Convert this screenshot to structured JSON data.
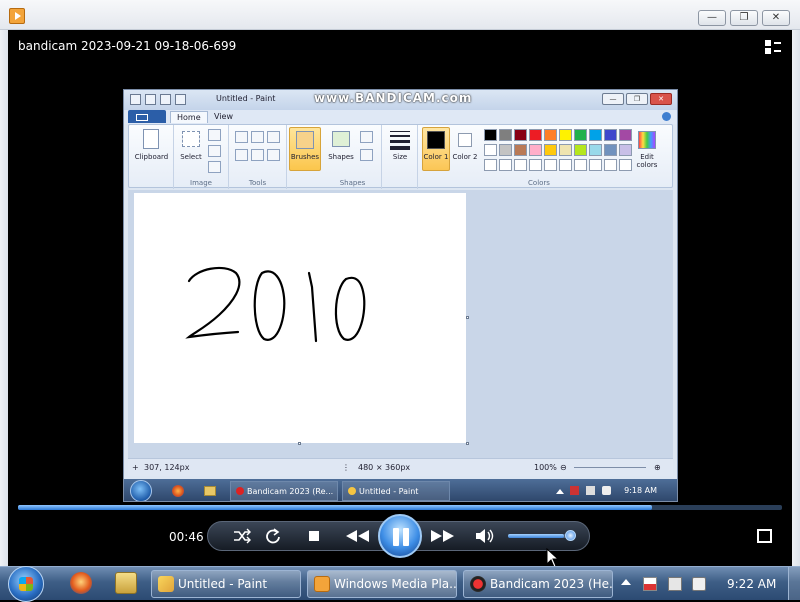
{
  "window": {
    "minimize": "—",
    "maximize": "❐",
    "close": "✕"
  },
  "player": {
    "video_title": "bandicam 2023-09-21 09-18-06-699",
    "elapsed": "00:46",
    "progress": 0.83,
    "volume": 0.9
  },
  "recording": {
    "paint": {
      "title": "Untitled - Paint",
      "watermark": "www.BANDICAM.com",
      "tabs": [
        "Home",
        "View"
      ],
      "groups": {
        "clipboard": "Clipboard",
        "image": "Image",
        "select": "Select",
        "tools": "Tools",
        "brushes": "Brushes",
        "shapes_btn": "Shapes",
        "shapes": "Shapes",
        "size": "Size",
        "color1": "Color 1",
        "color2": "Color 2",
        "edit_colors": "Edit colors",
        "colors": "Colors"
      },
      "palette_row1": [
        "#000000",
        "#7f7f7f",
        "#880015",
        "#ed1c24",
        "#ff7f27",
        "#fff200",
        "#22b14c",
        "#00a2e8",
        "#3f48cc",
        "#a349a4"
      ],
      "palette_row2": [
        "#ffffff",
        "#c3c3c3",
        "#b97a57",
        "#ffaec9",
        "#ffc90e",
        "#efe4b0",
        "#b5e61d",
        "#99d9ea",
        "#7092be",
        "#c8bfe7"
      ],
      "drawing_text": "2010",
      "status": {
        "cursor": "307, 124px",
        "size": "480 × 360px",
        "zoom": "100%"
      },
      "taskbar": {
        "btn1": "Bandicam 2023 (Re...",
        "btn2": "Untitled - Paint",
        "clock": "9:18 AM"
      }
    }
  },
  "taskbar": {
    "items": [
      "Untitled - Paint",
      "Windows Media Pla...",
      "Bandicam 2023 (He..."
    ],
    "clock": "9:22 AM"
  }
}
